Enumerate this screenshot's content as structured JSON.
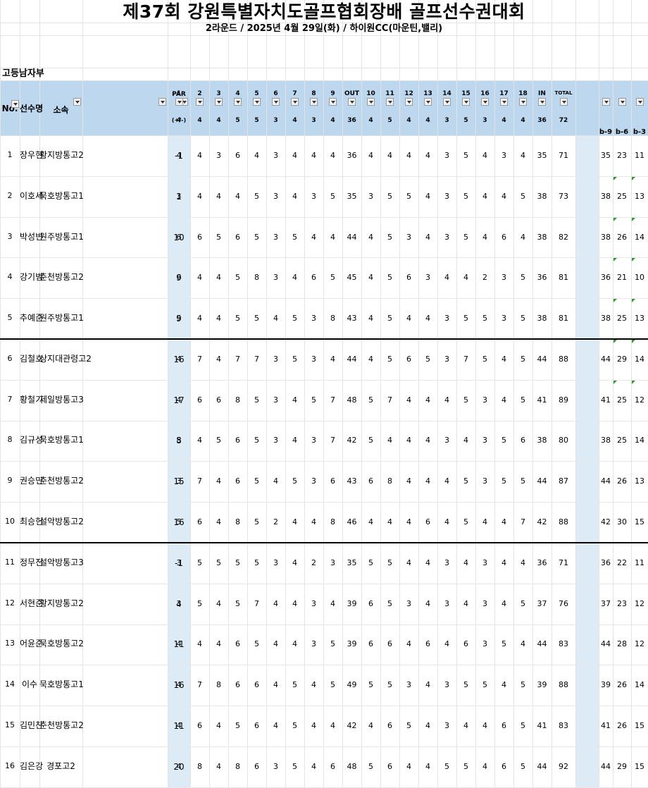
{
  "title": "제37회 강원특별자치도골프협회장배 골프선수권대회",
  "subtitle": "2라운드 / 2025년 4월 29일(화) / 하이원CC(마운틴,밸리)",
  "section": "고등남자부",
  "header": {
    "no": "No.",
    "name": "선수명",
    "school": "소속",
    "par": "PAR",
    "diff": "(+/-)",
    "holes": [
      "1",
      "2",
      "3",
      "4",
      "5",
      "6",
      "7",
      "8",
      "9",
      "OUT",
      "10",
      "11",
      "12",
      "13",
      "14",
      "15",
      "16",
      "17",
      "18",
      "IN",
      "TOTAL"
    ],
    "pars": [
      "4",
      "4",
      "4",
      "5",
      "5",
      "3",
      "4",
      "3",
      "4",
      "36",
      "4",
      "5",
      "4",
      "4",
      "3",
      "5",
      "3",
      "4",
      "4",
      "36",
      "72"
    ],
    "backs": [
      "b-9",
      "b-6",
      "b-3"
    ]
  },
  "players": [
    {
      "no": "1",
      "name": "장우현",
      "school": "황지방통고2",
      "diff": "-1",
      "scores": [
        "4",
        "4",
        "3",
        "6",
        "4",
        "3",
        "4",
        "4",
        "4",
        "36",
        "4",
        "4",
        "4",
        "4",
        "3",
        "5",
        "4",
        "3",
        "4",
        "35",
        "71"
      ],
      "b": [
        "35",
        "23",
        "11"
      ]
    },
    {
      "no": "2",
      "name": "이호세",
      "school": "묵호방통고1",
      "diff": "1",
      "scores": [
        "3",
        "4",
        "4",
        "4",
        "5",
        "3",
        "4",
        "3",
        "5",
        "35",
        "3",
        "5",
        "5",
        "4",
        "3",
        "5",
        "4",
        "4",
        "5",
        "38",
        "73"
      ],
      "b": [
        "38",
        "25",
        "13"
      ]
    },
    {
      "no": "3",
      "name": "박성빈",
      "school": "원주방통고1",
      "diff": "10",
      "scores": [
        "6",
        "6",
        "5",
        "6",
        "5",
        "3",
        "5",
        "4",
        "4",
        "44",
        "4",
        "5",
        "3",
        "4",
        "3",
        "5",
        "4",
        "6",
        "4",
        "38",
        "82"
      ],
      "b": [
        "38",
        "26",
        "14"
      ]
    },
    {
      "no": "4",
      "name": "강기범",
      "school": "춘천방통고2",
      "diff": "9",
      "scores": [
        "6",
        "4",
        "4",
        "5",
        "8",
        "3",
        "4",
        "6",
        "5",
        "45",
        "4",
        "5",
        "6",
        "3",
        "4",
        "4",
        "2",
        "3",
        "5",
        "36",
        "81"
      ],
      "b": [
        "36",
        "21",
        "10"
      ]
    },
    {
      "no": "5",
      "name": "추예준",
      "school": "원주방통고1",
      "diff": "9",
      "scores": [
        "5",
        "4",
        "4",
        "5",
        "5",
        "4",
        "5",
        "3",
        "8",
        "43",
        "4",
        "5",
        "4",
        "4",
        "3",
        "5",
        "5",
        "3",
        "5",
        "38",
        "81"
      ],
      "b": [
        "38",
        "25",
        "13"
      ]
    },
    {
      "no": "6",
      "name": "김철호",
      "school": "상지대관령고2",
      "diff": "16",
      "scores": [
        "4",
        "7",
        "4",
        "7",
        "7",
        "3",
        "5",
        "3",
        "4",
        "44",
        "4",
        "5",
        "6",
        "5",
        "3",
        "7",
        "5",
        "4",
        "5",
        "44",
        "88"
      ],
      "b": [
        "44",
        "29",
        "14"
      ]
    },
    {
      "no": "7",
      "name": "황철기",
      "school": "제일방통고3",
      "diff": "17",
      "scores": [
        "4",
        "6",
        "6",
        "8",
        "5",
        "3",
        "4",
        "5",
        "7",
        "48",
        "5",
        "7",
        "4",
        "4",
        "4",
        "5",
        "3",
        "4",
        "5",
        "41",
        "89"
      ],
      "b": [
        "41",
        "25",
        "12"
      ]
    },
    {
      "no": "8",
      "name": "김규성",
      "school": "묵호방통고1",
      "diff": "8",
      "scores": [
        "5",
        "4",
        "5",
        "6",
        "5",
        "3",
        "4",
        "3",
        "7",
        "42",
        "5",
        "4",
        "4",
        "4",
        "3",
        "4",
        "3",
        "5",
        "6",
        "38",
        "80"
      ],
      "b": [
        "38",
        "25",
        "14"
      ]
    },
    {
      "no": "9",
      "name": "권승민",
      "school": "춘천방통고2",
      "diff": "15",
      "scores": [
        "3",
        "7",
        "4",
        "6",
        "5",
        "4",
        "5",
        "3",
        "6",
        "43",
        "6",
        "8",
        "4",
        "4",
        "4",
        "5",
        "3",
        "5",
        "5",
        "44",
        "87"
      ],
      "b": [
        "44",
        "26",
        "13"
      ]
    },
    {
      "no": "10",
      "name": "최승헌",
      "school": "설악방통고2",
      "diff": "16",
      "scores": [
        "5",
        "6",
        "4",
        "8",
        "5",
        "2",
        "4",
        "4",
        "8",
        "46",
        "4",
        "4",
        "4",
        "6",
        "4",
        "5",
        "4",
        "4",
        "7",
        "42",
        "88"
      ],
      "b": [
        "42",
        "30",
        "15"
      ]
    },
    {
      "no": "11",
      "name": "정무진",
      "school": "설악방통고3",
      "diff": "-1",
      "scores": [
        "3",
        "5",
        "5",
        "5",
        "5",
        "3",
        "4",
        "2",
        "3",
        "35",
        "5",
        "5",
        "4",
        "4",
        "3",
        "4",
        "3",
        "4",
        "4",
        "36",
        "71"
      ],
      "b": [
        "36",
        "22",
        "11"
      ]
    },
    {
      "no": "12",
      "name": "서현준",
      "school": "황지방통고2",
      "diff": "4",
      "scores": [
        "3",
        "5",
        "4",
        "5",
        "7",
        "4",
        "4",
        "3",
        "4",
        "39",
        "6",
        "5",
        "3",
        "4",
        "3",
        "4",
        "3",
        "4",
        "5",
        "37",
        "76"
      ],
      "b": [
        "37",
        "23",
        "12"
      ]
    },
    {
      "no": "13",
      "name": "어윤준",
      "school": "묵호방통고2",
      "diff": "11",
      "scores": [
        "4",
        "4",
        "4",
        "6",
        "5",
        "4",
        "4",
        "3",
        "5",
        "39",
        "6",
        "6",
        "4",
        "6",
        "4",
        "6",
        "3",
        "5",
        "4",
        "44",
        "83"
      ],
      "b": [
        "44",
        "28",
        "12"
      ]
    },
    {
      "no": "14",
      "name": "이수",
      "school": "묵호방통고1",
      "diff": "16",
      "scores": [
        "4",
        "7",
        "8",
        "6",
        "6",
        "4",
        "5",
        "4",
        "5",
        "49",
        "5",
        "5",
        "3",
        "4",
        "3",
        "5",
        "5",
        "4",
        "5",
        "39",
        "88"
      ],
      "b": [
        "39",
        "26",
        "14"
      ]
    },
    {
      "no": "15",
      "name": "김민찬",
      "school": "춘천방통고2",
      "diff": "11",
      "scores": [
        "4",
        "6",
        "4",
        "5",
        "6",
        "4",
        "5",
        "4",
        "4",
        "42",
        "4",
        "6",
        "5",
        "4",
        "3",
        "4",
        "4",
        "6",
        "5",
        "41",
        "83"
      ],
      "b": [
        "41",
        "26",
        "15"
      ]
    },
    {
      "no": "16",
      "name": "김은강",
      "school": "경포고2",
      "diff": "20",
      "scores": [
        "4",
        "8",
        "4",
        "8",
        "6",
        "3",
        "5",
        "4",
        "6",
        "48",
        "5",
        "6",
        "4",
        "4",
        "5",
        "5",
        "4",
        "6",
        "5",
        "44",
        "92"
      ],
      "b": [
        "44",
        "29",
        "15"
      ]
    }
  ]
}
